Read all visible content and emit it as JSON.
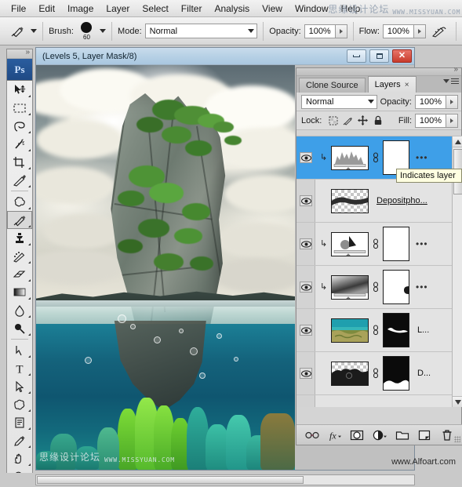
{
  "app": {
    "name": "Adobe Photoshop",
    "logo_text": "Ps"
  },
  "menubar": {
    "items": [
      {
        "label": "File"
      },
      {
        "label": "Edit"
      },
      {
        "label": "Image"
      },
      {
        "label": "Layer"
      },
      {
        "label": "Select"
      },
      {
        "label": "Filter"
      },
      {
        "label": "Analysis"
      },
      {
        "label": "View"
      },
      {
        "label": "Window"
      },
      {
        "label": "Help"
      }
    ]
  },
  "watermark_top": {
    "chinese": "思缘设计论坛",
    "url": "WWW.MISSYUAN.COM"
  },
  "watermark_doc": {
    "chinese": "思缘设计论坛",
    "url": "WWW.MISSYUAN.COM"
  },
  "watermark_right": {
    "url": "www.Alfoart.com"
  },
  "options_bar": {
    "tool_icon": "brush-tool-icon",
    "brush_label": "Brush:",
    "brush_size": "60",
    "mode_label": "Mode:",
    "mode_value": "Normal",
    "opacity_label": "Opacity:",
    "opacity_value": "100%",
    "flow_label": "Flow:",
    "flow_value": "100%",
    "airbrush_icon": "airbrush-icon"
  },
  "toolbox": {
    "tools": [
      {
        "name": "move-tool",
        "selected": false
      },
      {
        "name": "rectangular-marquee-tool",
        "selected": false
      },
      {
        "name": "lasso-tool",
        "selected": false
      },
      {
        "name": "magic-wand-tool",
        "selected": false
      },
      {
        "name": "crop-tool",
        "selected": false
      },
      {
        "name": "slice-tool",
        "selected": false
      },
      {
        "name": "healing-brush-tool",
        "selected": false
      },
      {
        "name": "brush-tool",
        "selected": true
      },
      {
        "name": "clone-stamp-tool",
        "selected": false
      },
      {
        "name": "history-brush-tool",
        "selected": false
      },
      {
        "name": "eraser-tool",
        "selected": false
      },
      {
        "name": "gradient-tool",
        "selected": false
      },
      {
        "name": "blur-tool",
        "selected": false
      },
      {
        "name": "dodge-tool",
        "selected": false
      },
      {
        "name": "pen-tool",
        "selected": false
      },
      {
        "name": "type-tool",
        "selected": false
      },
      {
        "name": "path-selection-tool",
        "selected": false
      },
      {
        "name": "custom-shape-tool",
        "selected": false
      },
      {
        "name": "notes-tool",
        "selected": false
      },
      {
        "name": "eyedropper-tool",
        "selected": false
      },
      {
        "name": "hand-tool",
        "selected": false
      },
      {
        "name": "zoom-tool",
        "selected": false
      }
    ]
  },
  "document": {
    "title": "(Levels 5, Layer Mask/8)",
    "minimize_label": "Minimize",
    "maximize_label": "Maximize",
    "close_label": "Close"
  },
  "panel": {
    "tabs": [
      {
        "label": "Clone Source",
        "active": false,
        "closable": false
      },
      {
        "label": "Layers",
        "active": true,
        "closable": true
      }
    ],
    "close_glyph": "×",
    "blend_mode": "Normal",
    "opacity_label": "Opacity:",
    "opacity_value": "100%",
    "lock_label": "Lock:",
    "fill_label": "Fill:",
    "fill_value": "100%",
    "lock_icons": [
      "lock-transparent-pixels-icon",
      "lock-image-pixels-icon",
      "lock-position-icon",
      "lock-all-icon"
    ],
    "layers": [
      {
        "name": "",
        "name_display": "•••",
        "type": "adjustment-levels",
        "thumb": "levels-histogram",
        "mask": "white",
        "selected": true,
        "clipped": true,
        "visible": true
      },
      {
        "name": "Depositpho...",
        "name_display": "Depositpho...",
        "type": "smart-object",
        "thumb": "transparent-strip",
        "mask": "none",
        "selected": false,
        "clipped": false,
        "visible": true,
        "underlined": true
      },
      {
        "name": "",
        "name_display": "•••",
        "type": "adjustment-curves",
        "thumb": "curves-graph",
        "mask": "white",
        "selected": false,
        "clipped": true,
        "visible": true
      },
      {
        "name": "",
        "name_display": "•••",
        "type": "adjustment-gradient-map",
        "thumb": "gradient-map",
        "mask": "white",
        "selected": false,
        "clipped": true,
        "visible": true
      },
      {
        "name": "L...",
        "name_display": "L...",
        "type": "image",
        "thumb": "underwater-reef-photo",
        "mask": "black",
        "selected": false,
        "clipped": false,
        "visible": true
      },
      {
        "name": "D...",
        "name_display": "D...",
        "type": "image",
        "thumb": "rock-silhouette",
        "mask": "black",
        "selected": false,
        "clipped": false,
        "visible": true
      }
    ],
    "bottom_buttons": [
      {
        "name": "link-layers-button",
        "glyph": "link-icon"
      },
      {
        "name": "layer-style-button",
        "glyph": "fx-icon"
      },
      {
        "name": "add-layer-mask-button",
        "glyph": "mask-icon"
      },
      {
        "name": "new-adjustment-layer-button",
        "glyph": "half-circle-icon"
      },
      {
        "name": "new-group-button",
        "glyph": "folder-icon"
      },
      {
        "name": "new-layer-button",
        "glyph": "new-layer-icon"
      },
      {
        "name": "delete-layer-button",
        "glyph": "trash-icon"
      }
    ]
  },
  "tooltip": {
    "text": "Indicates layer"
  }
}
